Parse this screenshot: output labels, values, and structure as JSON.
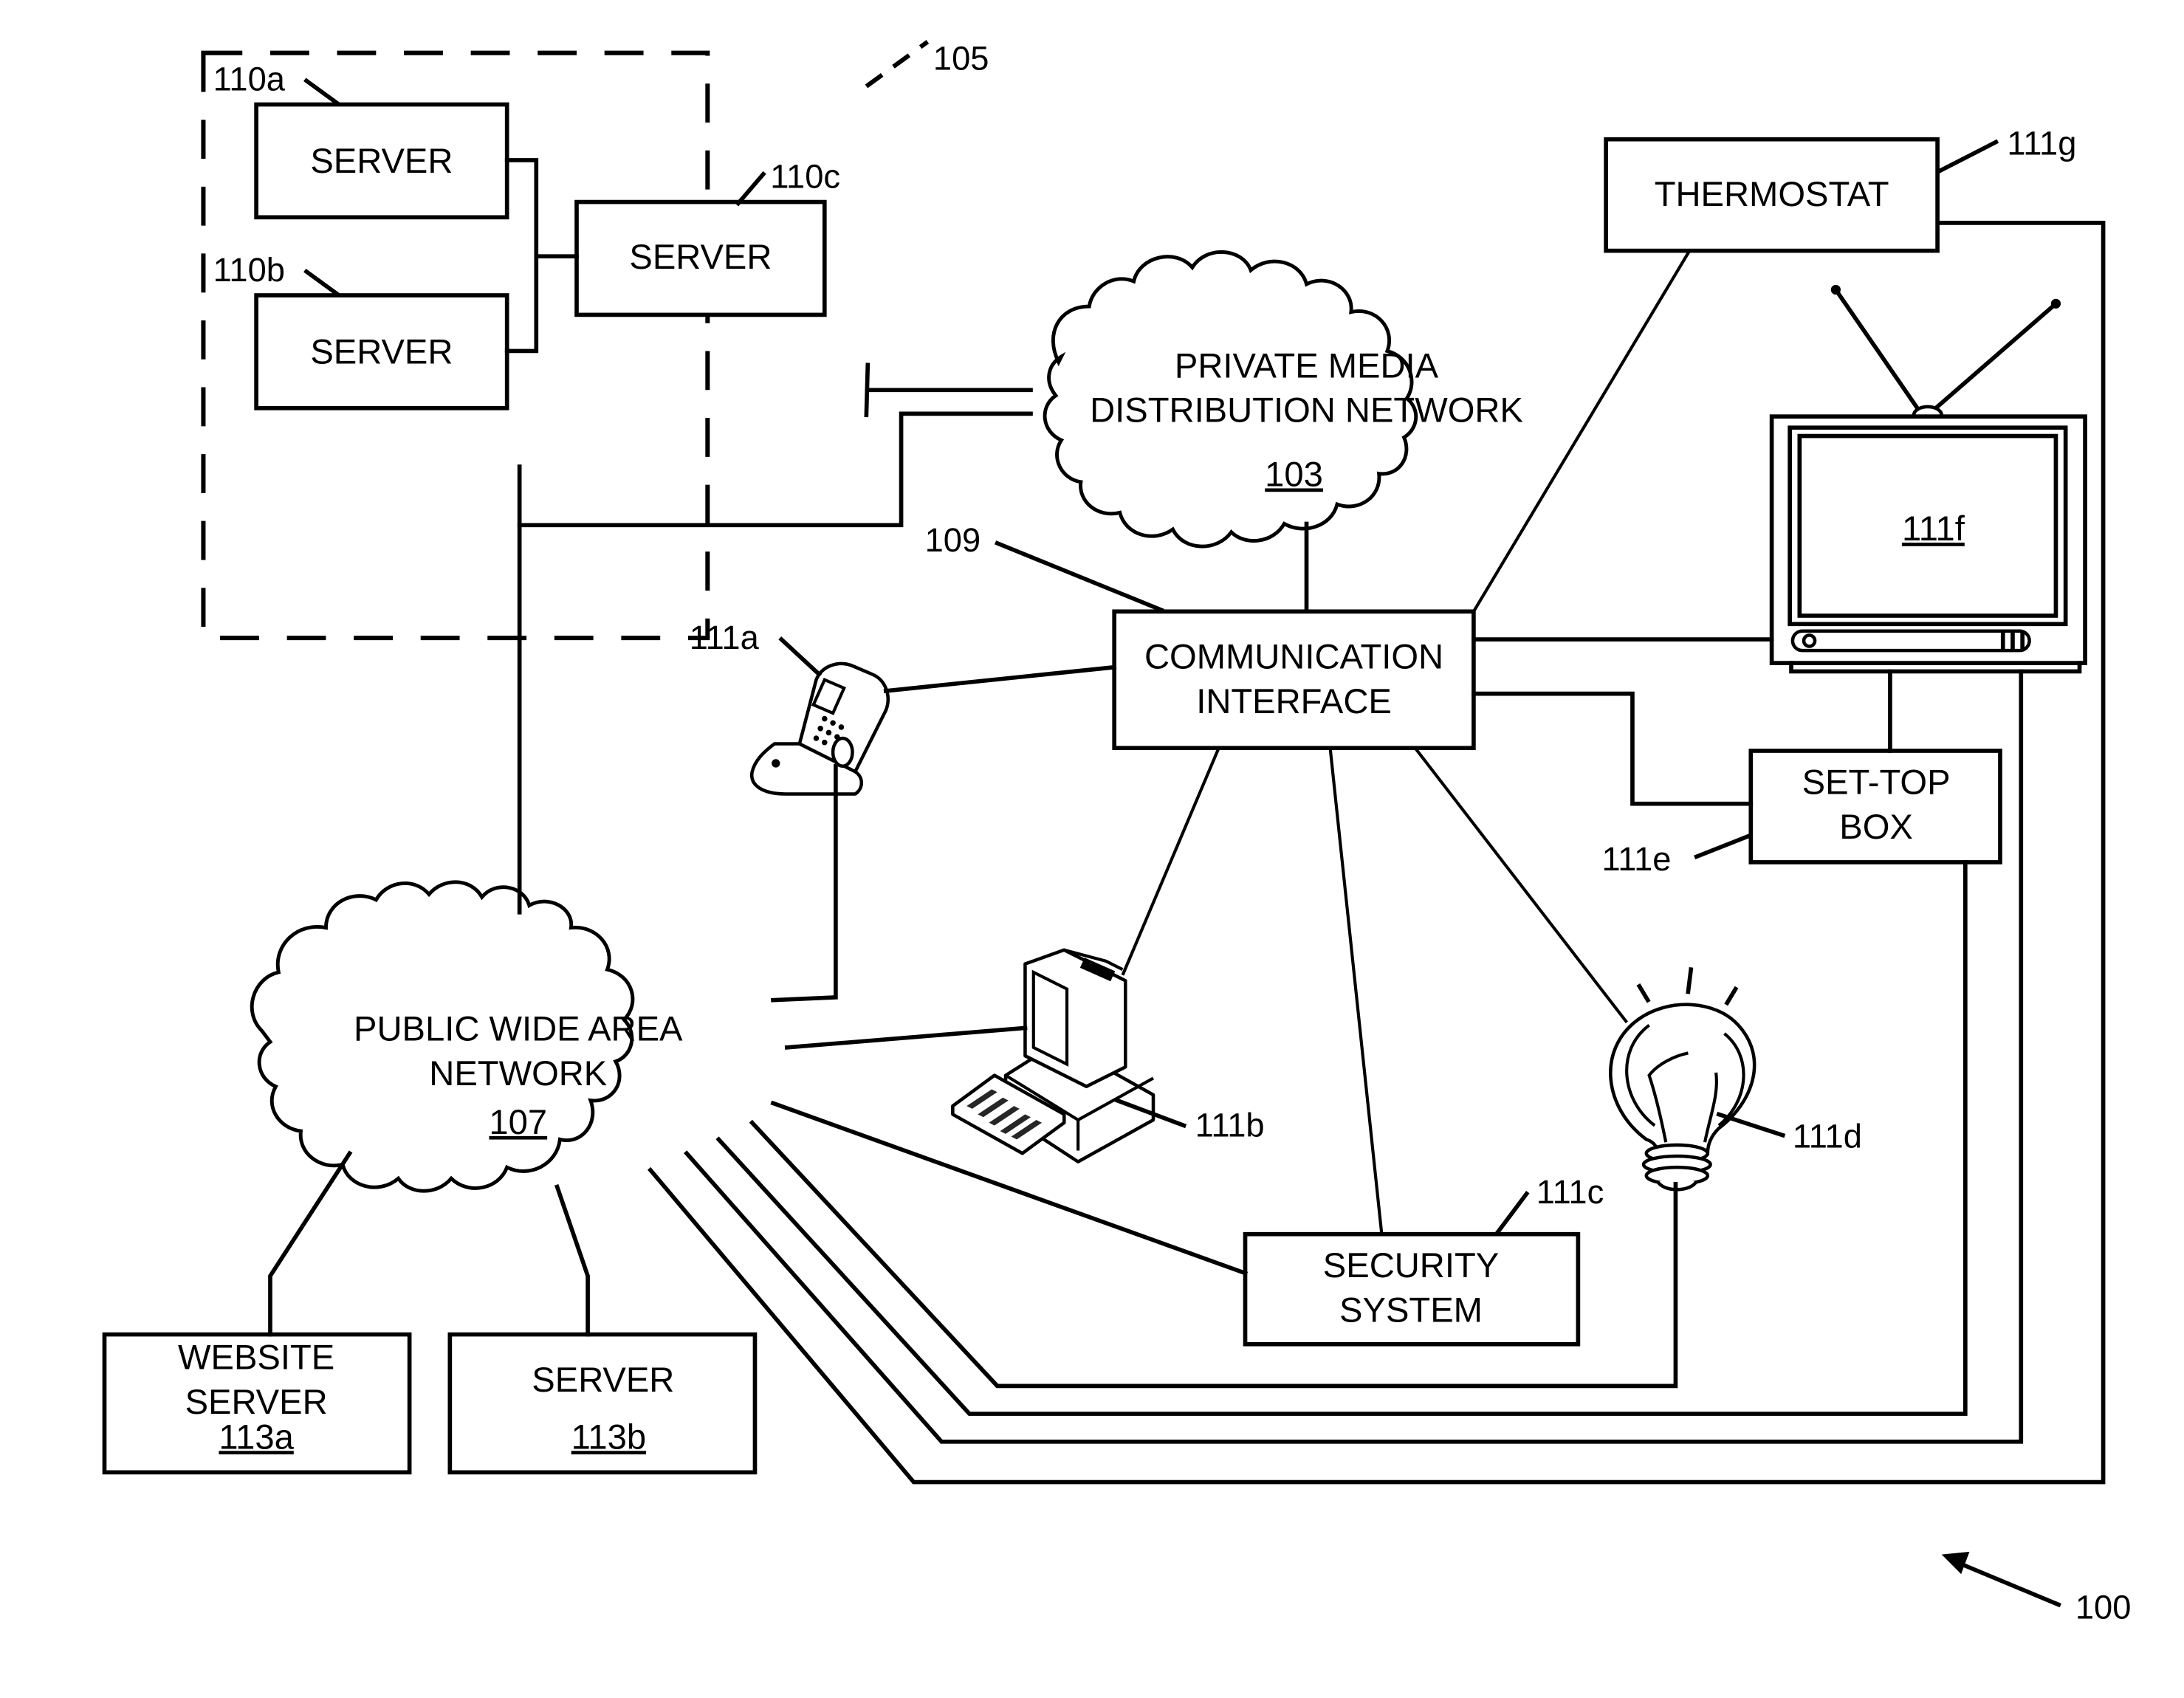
{
  "figure": {
    "figure_ref": "100",
    "server_group": {
      "ref": "105",
      "servers": [
        {
          "ref": "110a",
          "label": "SERVER"
        },
        {
          "ref": "110b",
          "label": "SERVER"
        },
        {
          "ref": "110c",
          "label": "SERVER"
        }
      ]
    },
    "private_network": {
      "line1": "PRIVATE MEDIA",
      "line2": "DISTRIBUTION NETWORK",
      "ref": "103"
    },
    "public_network": {
      "line1": "PUBLIC WIDE AREA",
      "line2": "NETWORK",
      "ref": "107"
    },
    "communication_interface": {
      "ref": "109",
      "line1": "COMMUNICATION",
      "line2": "INTERFACE"
    },
    "devices": {
      "mobile_phone": {
        "ref": "111a"
      },
      "computer": {
        "ref": "111b"
      },
      "security_system": {
        "ref": "111c",
        "line1": "SECURITY",
        "line2": "SYSTEM"
      },
      "light_bulb": {
        "ref": "111d"
      },
      "set_top_box": {
        "ref": "111e",
        "line1": "SET-TOP",
        "line2": "BOX"
      },
      "television": {
        "ref": "111f"
      },
      "thermostat": {
        "ref": "111g",
        "label": "THERMOSTAT"
      }
    },
    "external_servers": [
      {
        "line1": "WEBSITE",
        "line2": "SERVER",
        "ref": "113a"
      },
      {
        "line1": "SERVER",
        "ref": "113b"
      }
    ]
  }
}
